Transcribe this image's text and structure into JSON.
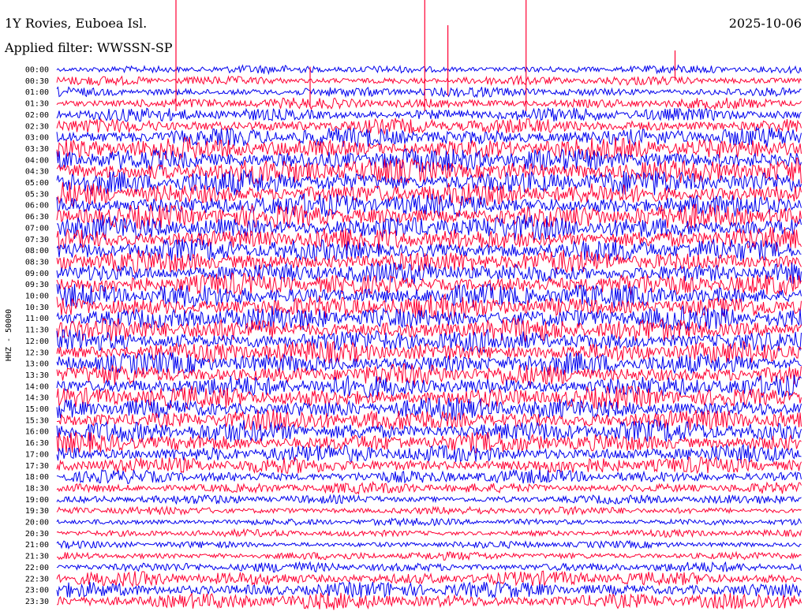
{
  "header": {
    "station": "1Y Rovies, Euboea Isl.",
    "date": "2025-10-06",
    "filter_label": "Applied filter: WWSSN-SP"
  },
  "chart_data": {
    "type": "line",
    "ylabel": "HHZ - 50000",
    "row_labels": [
      "00:00",
      "00:30",
      "01:00",
      "01:30",
      "02:00",
      "02:30",
      "03:00",
      "03:30",
      "04:00",
      "04:30",
      "05:00",
      "05:30",
      "06:00",
      "06:30",
      "07:00",
      "07:30",
      "08:00",
      "08:30",
      "09:00",
      "09:30",
      "10:00",
      "10:30",
      "11:00",
      "11:30",
      "12:00",
      "12:30",
      "13:00",
      "13:30",
      "14:00",
      "14:30",
      "15:00",
      "15:30",
      "16:00",
      "16:30",
      "17:00",
      "17:30",
      "18:00",
      "18:30",
      "19:00",
      "19:30",
      "20:00",
      "20:30",
      "21:00",
      "21:30",
      "22:00",
      "22:30",
      "23:00",
      "23:30"
    ],
    "row_colors": [
      "#0000ee",
      "#ff0033"
    ],
    "row_amplitudes": [
      0.45,
      0.5,
      0.55,
      0.6,
      0.75,
      0.85,
      1.05,
      1.2,
      1.3,
      1.4,
      1.35,
      1.3,
      1.3,
      1.35,
      1.35,
      1.3,
      1.25,
      1.25,
      1.2,
      1.2,
      1.3,
      1.3,
      1.3,
      1.3,
      1.25,
      1.2,
      1.2,
      1.2,
      1.2,
      1.2,
      1.2,
      1.2,
      1.2,
      1.1,
      1.0,
      0.9,
      0.75,
      0.6,
      0.5,
      0.45,
      0.4,
      0.4,
      0.4,
      0.45,
      0.55,
      0.8,
      0.9,
      0.9
    ],
    "spikes": [
      {
        "row": 0,
        "time_frac": 0.16,
        "amplitude": 5.5
      },
      {
        "row": 0,
        "time_frac": 0.494,
        "amplitude": 5.5
      },
      {
        "row": 0,
        "time_frac": 0.525,
        "amplitude": 3.5
      },
      {
        "row": 0,
        "time_frac": 0.63,
        "amplitude": 5.5
      },
      {
        "row": 0,
        "time_frac": 0.83,
        "amplitude": 1.5
      },
      {
        "row": 2,
        "time_frac": 0.34,
        "amplitude": 2.0
      }
    ]
  }
}
